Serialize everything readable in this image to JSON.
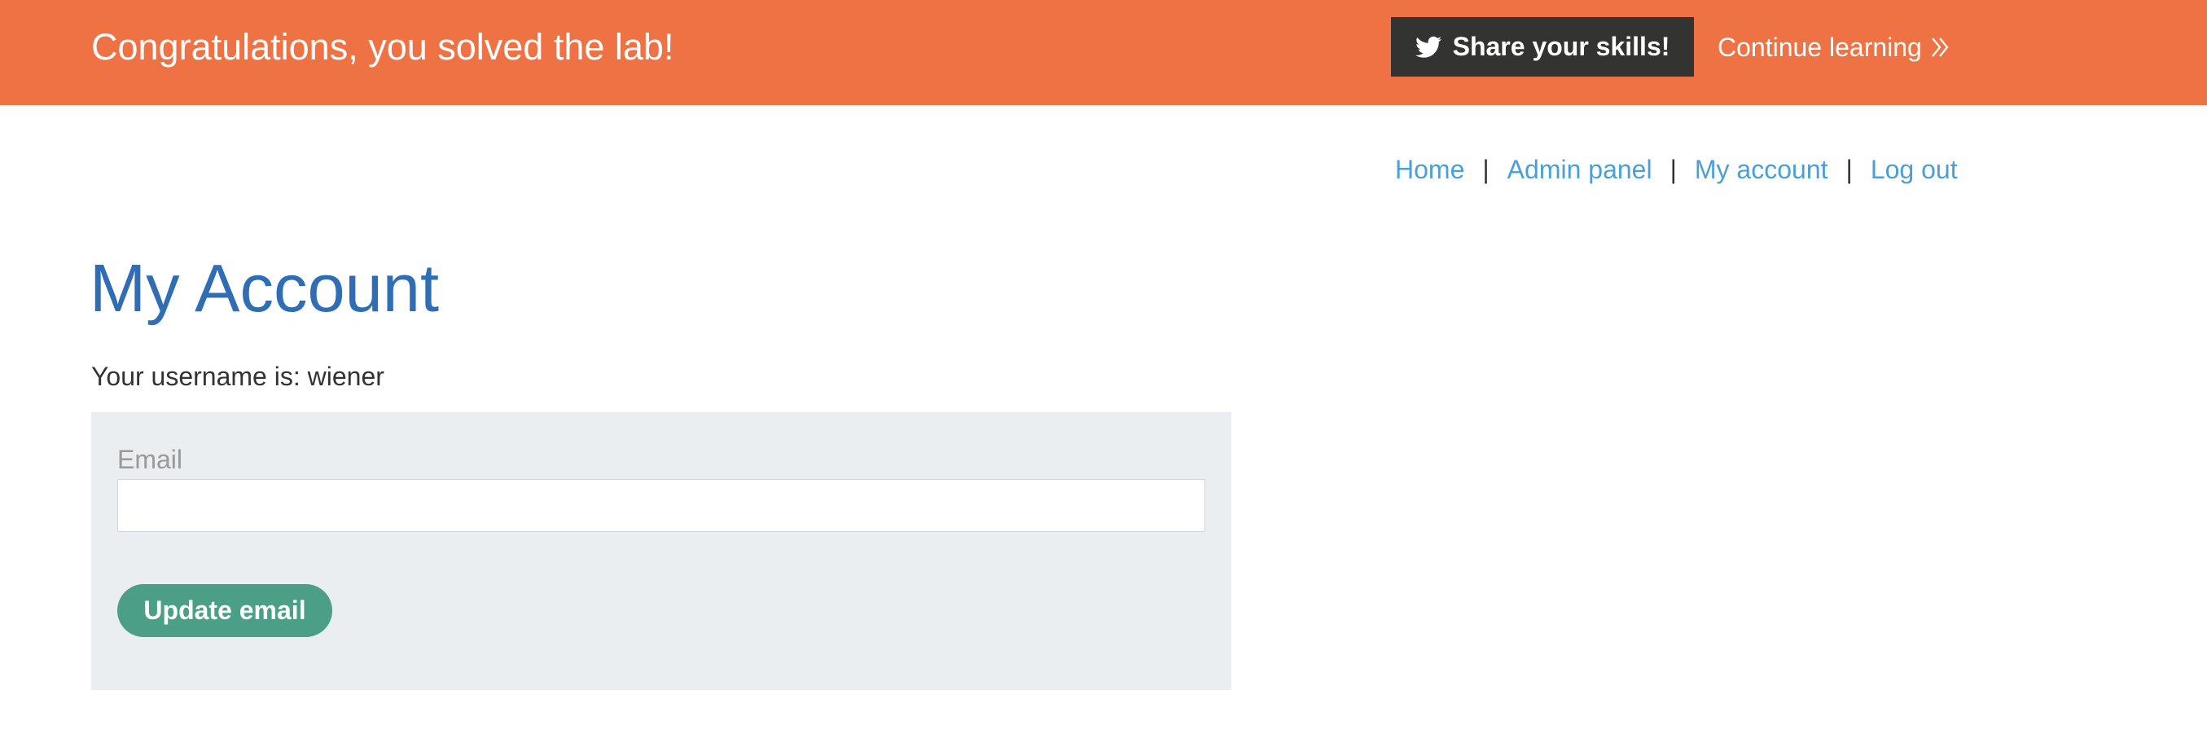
{
  "banner": {
    "title": "Congratulations, you solved the lab!",
    "share_label": "Share your skills!",
    "share_icon": "twitter-icon",
    "continue_label": "Continue learning",
    "continue_icon": "double-chevron-right-icon",
    "background_color": "#ee7244"
  },
  "nav": {
    "items": [
      {
        "label": "Home"
      },
      {
        "label": "Admin panel"
      },
      {
        "label": "My account"
      },
      {
        "label": "Log out"
      }
    ],
    "separator": "|",
    "link_color": "#4a9fd5"
  },
  "main": {
    "title": "My Account",
    "username_line": "Your username is: wiener",
    "title_color": "#2f6db5"
  },
  "form": {
    "email_label": "Email",
    "email_value": "",
    "email_placeholder": "",
    "submit_label": "Update email",
    "submit_color": "#4a9f86"
  }
}
